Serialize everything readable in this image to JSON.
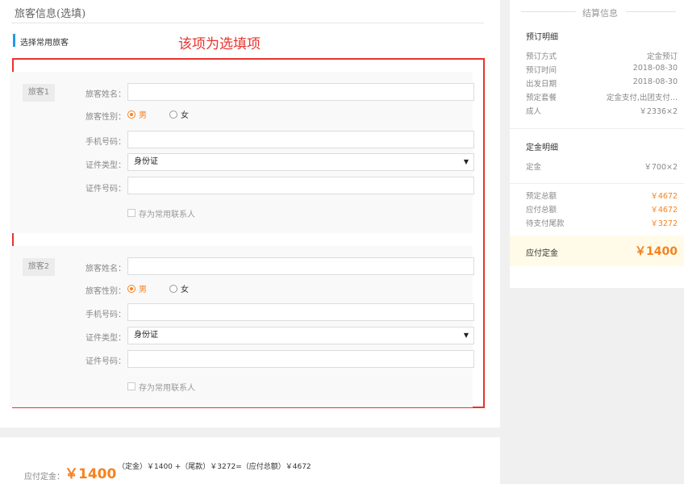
{
  "left": {
    "section_title": "旅客信息(选填)",
    "common_travelers_label": "选择常用旅客",
    "annotation": "该项为选填项",
    "travelers": [
      {
        "tag": "旅客1",
        "name_label": "旅客姓名：",
        "name_value": "",
        "gender_label": "旅客性别：",
        "gender_male": "男",
        "gender_female": "女",
        "phone_label": "手机号码：",
        "phone_value": "",
        "id_type_label": "证件类型：",
        "id_type_value": "身份证",
        "id_no_label": "证件号码：",
        "id_no_value": "",
        "save_contact_label": "存为常用联系人"
      },
      {
        "tag": "旅客2",
        "name_label": "旅客姓名：",
        "name_value": "",
        "gender_label": "旅客性别：",
        "gender_male": "男",
        "gender_female": "女",
        "phone_label": "手机号码：",
        "phone_value": "",
        "id_type_label": "证件类型：",
        "id_type_value": "身份证",
        "id_no_label": "证件号码：",
        "id_no_value": "",
        "save_contact_label": "存为常用联系人"
      }
    ]
  },
  "bottom": {
    "label": "应付定金：",
    "amount": "￥1400",
    "formula": "（定金）￥1400 +（尾款）￥3272=（应付总额）￥4672"
  },
  "summary": {
    "heading": "结算信息",
    "booking_detail_title": "预订明细",
    "booking_rows": [
      {
        "label": "预订方式",
        "value": "定金预订"
      },
      {
        "label": "预订时间",
        "value": "2018-08-30"
      },
      {
        "label": "出发日期",
        "value": "2018-08-30"
      },
      {
        "label": "预定套餐",
        "value": "定金支付,出团支付..."
      },
      {
        "label": "成人",
        "value": "￥2336×2"
      }
    ],
    "deposit_detail_title": "定金明细",
    "deposit_row": {
      "label": "定金",
      "value": "￥700×2"
    },
    "totals": [
      {
        "label": "预定总额",
        "value": "￥4672"
      },
      {
        "label": "应付总额",
        "value": "￥4672"
      },
      {
        "label": "待支付尾款",
        "value": "￥3272"
      }
    ],
    "deposit_due_label": "应付定金",
    "deposit_due_value": "￥1400"
  },
  "colors": {
    "accent_orange": "#f58220",
    "annotation_red": "#e8332c",
    "bar_blue": "#1e9be8"
  }
}
